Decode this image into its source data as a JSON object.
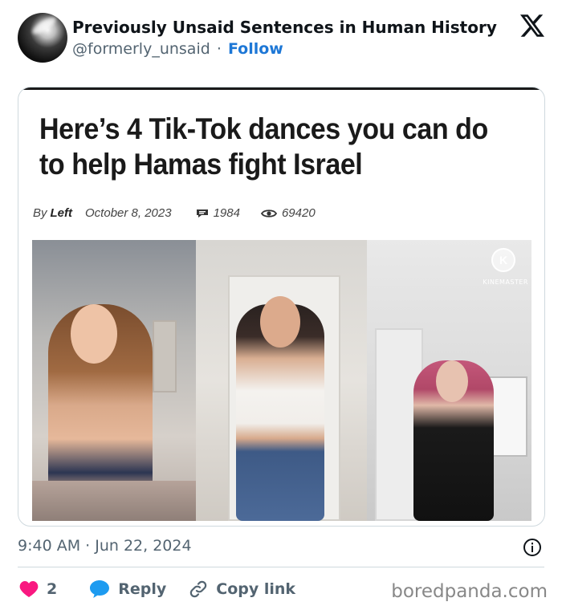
{
  "author": {
    "name": "Previously Unsaid Sentences in Human History",
    "handle": "@formerly_unsaid",
    "separator": "·",
    "follow_label": "Follow"
  },
  "article": {
    "headline": "Here’s 4 Tik-Tok dances you can do to help Hamas fight Israel",
    "by_label": "By",
    "by_name": "Left",
    "date": "October 8, 2023",
    "comments": "1984",
    "views": "69420",
    "overlay_brand": "KINEMASTER"
  },
  "tweet": {
    "timestamp": "9:40 AM · Jun 22, 2024"
  },
  "actions": {
    "like_count": "2",
    "reply_label": "Reply",
    "copy_link_label": "Copy link"
  },
  "watermark": "boredpanda.com",
  "colors": {
    "follow": "#1d77d6",
    "like": "#f91880",
    "reply": "#1d9bf0",
    "muted": "#536471"
  }
}
